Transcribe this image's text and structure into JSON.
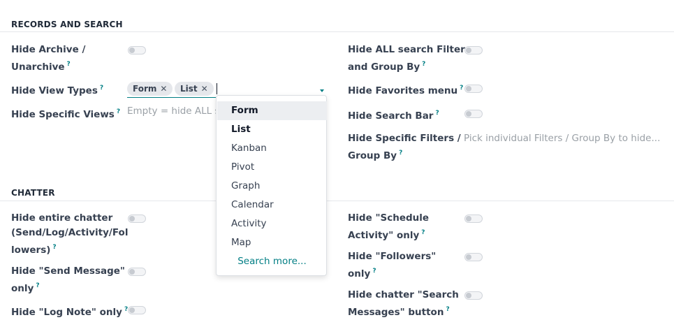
{
  "sections": {
    "records": "RECORDS AND SEARCH",
    "chatter": "CHATTER"
  },
  "records": {
    "hide_archive_1": "Hide Archive /",
    "hide_archive_2": "Unarchive",
    "hide_all_filters_1": "Hide ALL search Filters",
    "hide_all_filters_2": "and Group By",
    "hide_view_types": "Hide View Types",
    "hide_favorites": "Hide Favorites menu",
    "hide_specific_views": "Hide Specific Views",
    "hide_specific_views_placeholder": "Empty = hide ALL se",
    "hide_search_bar": "Hide Search Bar",
    "hide_specific_filters_1": "Hide Specific Filters /",
    "hide_specific_filters_2": "Group By",
    "hide_specific_filters_placeholder": "Pick individual Filters / Group By to hide..."
  },
  "view_type_tags": [
    "Form",
    "List"
  ],
  "tag_remove_glyph": "✕",
  "help_glyph": "?",
  "dropdown": {
    "options": [
      "Form",
      "List",
      "Kanban",
      "Pivot",
      "Graph",
      "Calendar",
      "Activity",
      "Map"
    ],
    "selected": [
      "Form",
      "List"
    ],
    "active": "Form",
    "search_more": "Search more..."
  },
  "chatter": {
    "hide_entire_1": "Hide entire chatter",
    "hide_entire_2": "(Send/Log/Activity/Fol",
    "hide_entire_3": "lowers)",
    "hide_schedule_1": "Hide \"Schedule",
    "hide_schedule_2": "Activity\" only",
    "hide_send_1": "Hide \"Send Message\"",
    "hide_send_2": "only",
    "hide_followers_1": "Hide \"Followers\"",
    "hide_followers_2": "only",
    "hide_log": "Hide \"Log Note\" only",
    "hide_search_msgs_1": "Hide chatter \"Search",
    "hide_search_msgs_2": "Messages\" button"
  },
  "colors": {
    "accent": "#017e84",
    "tag_bg": "#e5e7eb",
    "active_option_bg": "#eceef1"
  },
  "toggle_states": {
    "all_toggles_on": false
  }
}
